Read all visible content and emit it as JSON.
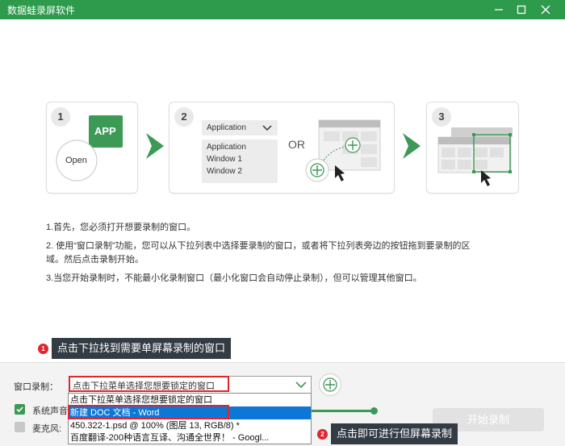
{
  "window": {
    "title": "数据蛙录屏软件"
  },
  "steps": {
    "step1": {
      "number": "1",
      "app_label": "APP",
      "open_label": "Open"
    },
    "step2": {
      "number": "2",
      "select_label": "Application",
      "list": [
        "Application",
        "Window 1",
        "Window 2"
      ],
      "or_label": "OR"
    },
    "step3": {
      "number": "3"
    }
  },
  "instructions": [
    "1.首先，您必须打开想要录制的窗口。",
    "2. 使用“窗口录制”功能，您可以从下拉列表中选择要录制的窗口，或者将下拉列表旁边的按钮拖到要录制的区",
    "域。然后点击录制开始。",
    "3.当您开始录制时，不能最小化录制窗口（最小化窗口会自动停止录制），但可以管理其他窗口。"
  ],
  "callout1": {
    "badge": "1",
    "text": "点击下拉找到需要单屏幕录制的窗口"
  },
  "callout2": {
    "badge": "2",
    "text": "点击即可进行但屏幕录制"
  },
  "controls": {
    "window_record_label": "窗口录制：",
    "select_value": "点击下拉菜单选择您想要锁定的窗口",
    "dropdown_items": [
      "点击下拉菜单选择您想要锁定的窗口",
      "新建 DOC 文档 - Word",
      "450.322-1.psd @ 100% (图层 13, RGB/8) *",
      "百度翻译-200种语言互译、沟通全世界！ - Googl..."
    ],
    "system_sound_label": "系统声音",
    "mic_label": "麦克风:",
    "start_button": "开始录制"
  },
  "colors": {
    "brand": "#2e9a4c",
    "highlight": "#0c77d6",
    "annotation": "#e0252d"
  }
}
